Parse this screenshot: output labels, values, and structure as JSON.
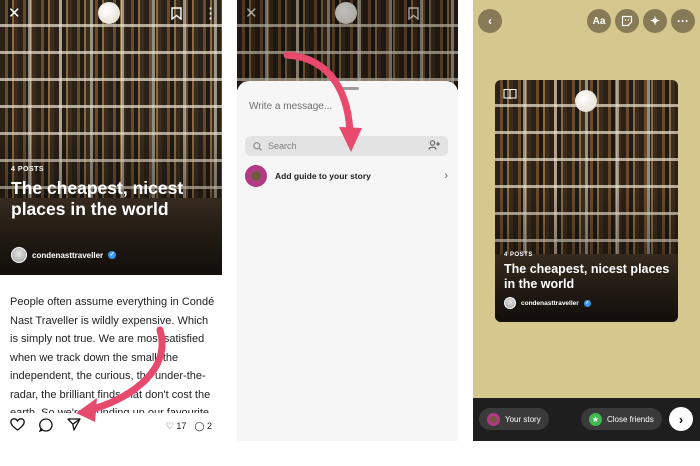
{
  "colors": {
    "arrow": "#e84a6e",
    "verified": "#3897f0",
    "close_friends": "#3fb950",
    "story_gradient": "#b13a86"
  },
  "panel_left": {
    "icons": {
      "close": "close-icon",
      "bookmark": "bookmark-icon",
      "more": "more-vertical-icon"
    },
    "guide": {
      "post_count": "4 POSTS",
      "title": "The cheapest, nicest places in the world",
      "author": "condenasttraveller"
    },
    "body_text": "People often assume everything in Condé Nast Traveller is wildly expensive. Which is simply not true. We are most satisfied when we track down the small, the independent, the curious, the under-the-radar, the brilliant finds that don't cost the earth. So we're rounding up our favourite affordable spots across the globe: hotels, winter-sun",
    "actions": {
      "like_count": "17",
      "comment_count": "2"
    }
  },
  "panel_middle": {
    "message_placeholder": "Write a message...",
    "search_placeholder": "Search",
    "add_guide_label": "Add guide to your story"
  },
  "panel_right": {
    "text_tool": "Aa",
    "guide": {
      "post_count": "4 POSTS",
      "title": "The cheapest, nicest places in the world",
      "author": "condenasttraveller"
    },
    "your_story": "Your story",
    "close_friends": "Close friends"
  }
}
